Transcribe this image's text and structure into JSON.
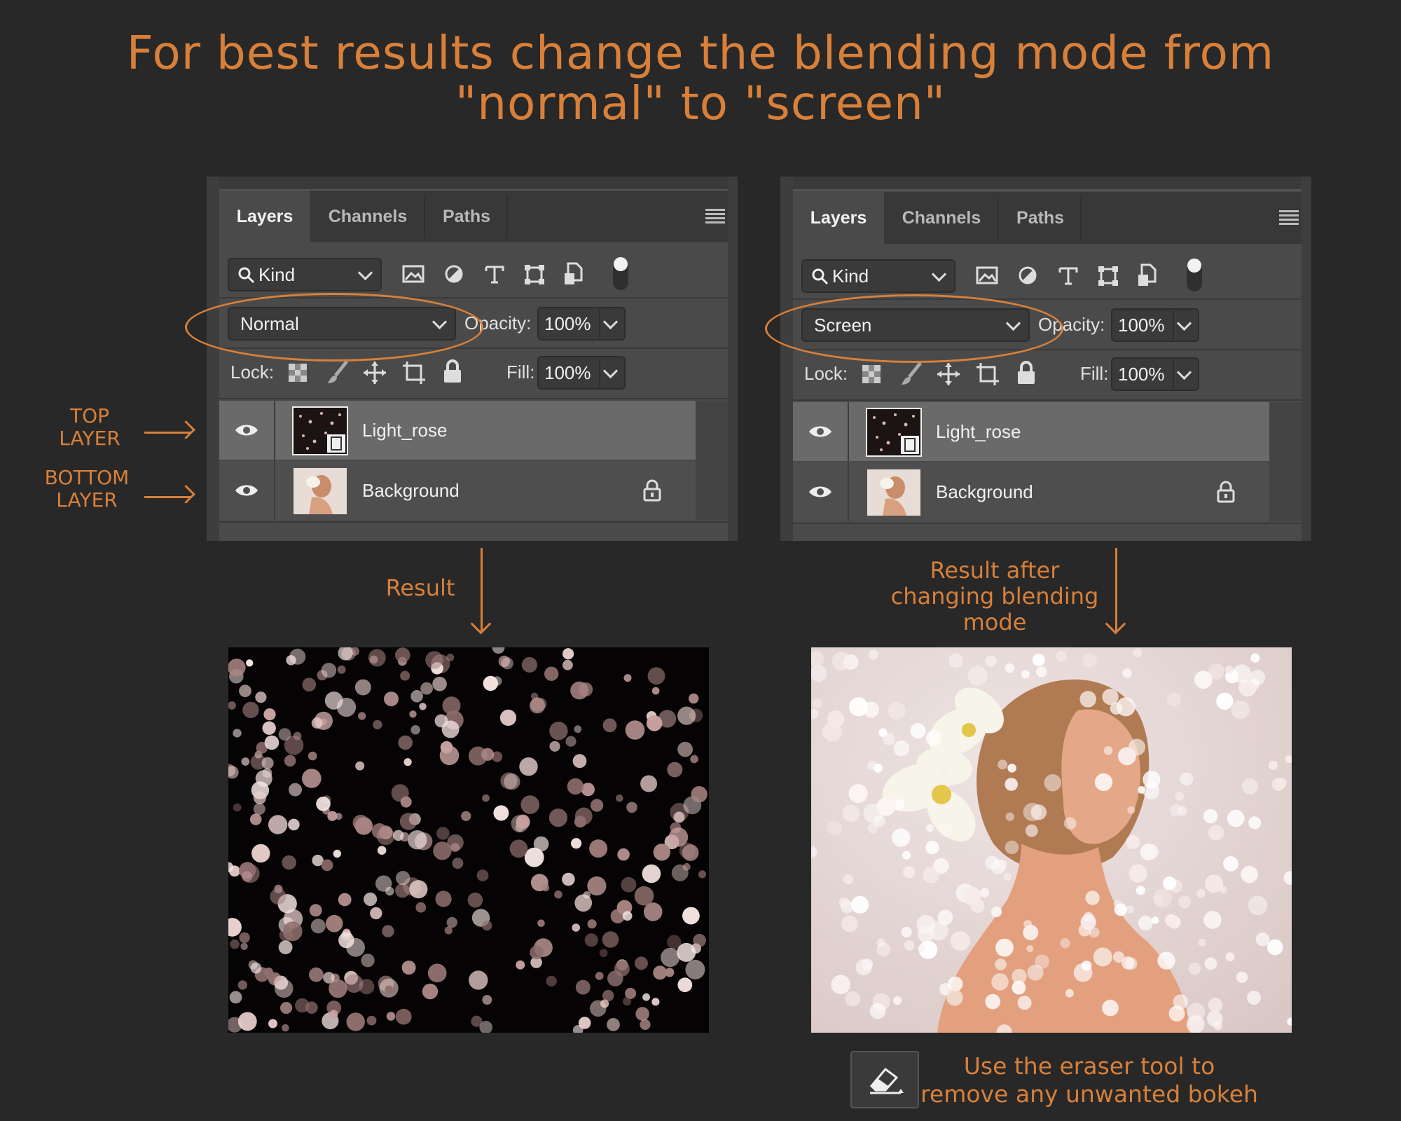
{
  "title": {
    "line1": "For best results change the blending mode from",
    "line2": "\"normal\"  to  \"screen\""
  },
  "side_labels": {
    "top": "TOP\nLAYER",
    "bottom": "BOTTOM\nLAYER"
  },
  "left_panel": {
    "tabs": [
      "Layers",
      "Channels",
      "Paths"
    ],
    "filter_kind": "Kind",
    "blend_mode": "Normal",
    "opacity_label": "Opacity:",
    "opacity_value": "100%",
    "lock_label": "Lock:",
    "fill_label": "Fill:",
    "fill_value": "100%",
    "layers": [
      {
        "name": "Light_rose"
      },
      {
        "name": "Background"
      }
    ]
  },
  "right_panel": {
    "tabs": [
      "Layers",
      "Channels",
      "Paths"
    ],
    "filter_kind": "Kind",
    "blend_mode": "Screen",
    "opacity_label": "Opacity:",
    "opacity_value": "100%",
    "lock_label": "Lock:",
    "fill_label": "Fill:",
    "fill_value": "100%",
    "layers": [
      {
        "name": "Light_rose"
      },
      {
        "name": "Background"
      }
    ]
  },
  "captions": {
    "result": "Result",
    "result_after": "Result after\nchanging blending\nmode",
    "eraser_tip": "Use the eraser tool to\nremove any unwanted bokeh"
  },
  "colors": {
    "accent": "#d8803a",
    "background": "#282828",
    "panel": "#4a4a4a"
  },
  "icons": [
    "search-icon",
    "image-filter-icon",
    "adjustment-filter-icon",
    "type-filter-icon",
    "shape-filter-icon",
    "smart-object-filter-icon",
    "filter-toggle",
    "eye-icon",
    "lock-icon",
    "eraser-icon"
  ]
}
